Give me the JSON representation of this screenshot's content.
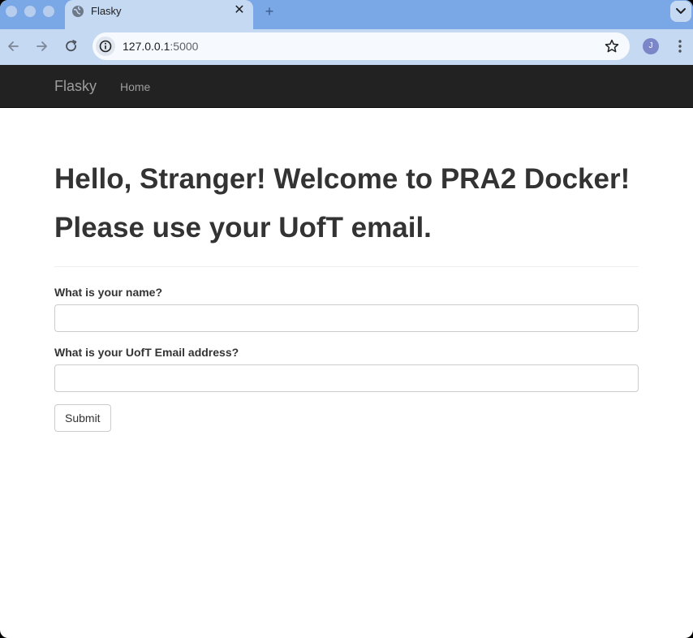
{
  "browser": {
    "tab_title": "Flasky",
    "tab_close": "✕",
    "new_tab": "+",
    "url_host": "127.0.0.1",
    "url_port": ":5000",
    "avatar_initial": "J"
  },
  "navbar": {
    "brand": "Flasky",
    "home": "Home"
  },
  "page": {
    "heading_line1": "Hello, Stranger! Welcome to PRA2 Docker!",
    "heading_line2": "Please use your UofT email."
  },
  "form": {
    "name_label": "What is your name?",
    "name_value": "",
    "email_label": "What is your UofT Email address?",
    "email_value": "",
    "submit_label": "Submit"
  },
  "colors": {
    "navbar_bg": "#222222",
    "navbar_text": "#9d9d9d",
    "heading_text": "#333333",
    "tabstrip_bg": "#7aa7e6",
    "toolbar_bg": "#c6d9f3"
  }
}
